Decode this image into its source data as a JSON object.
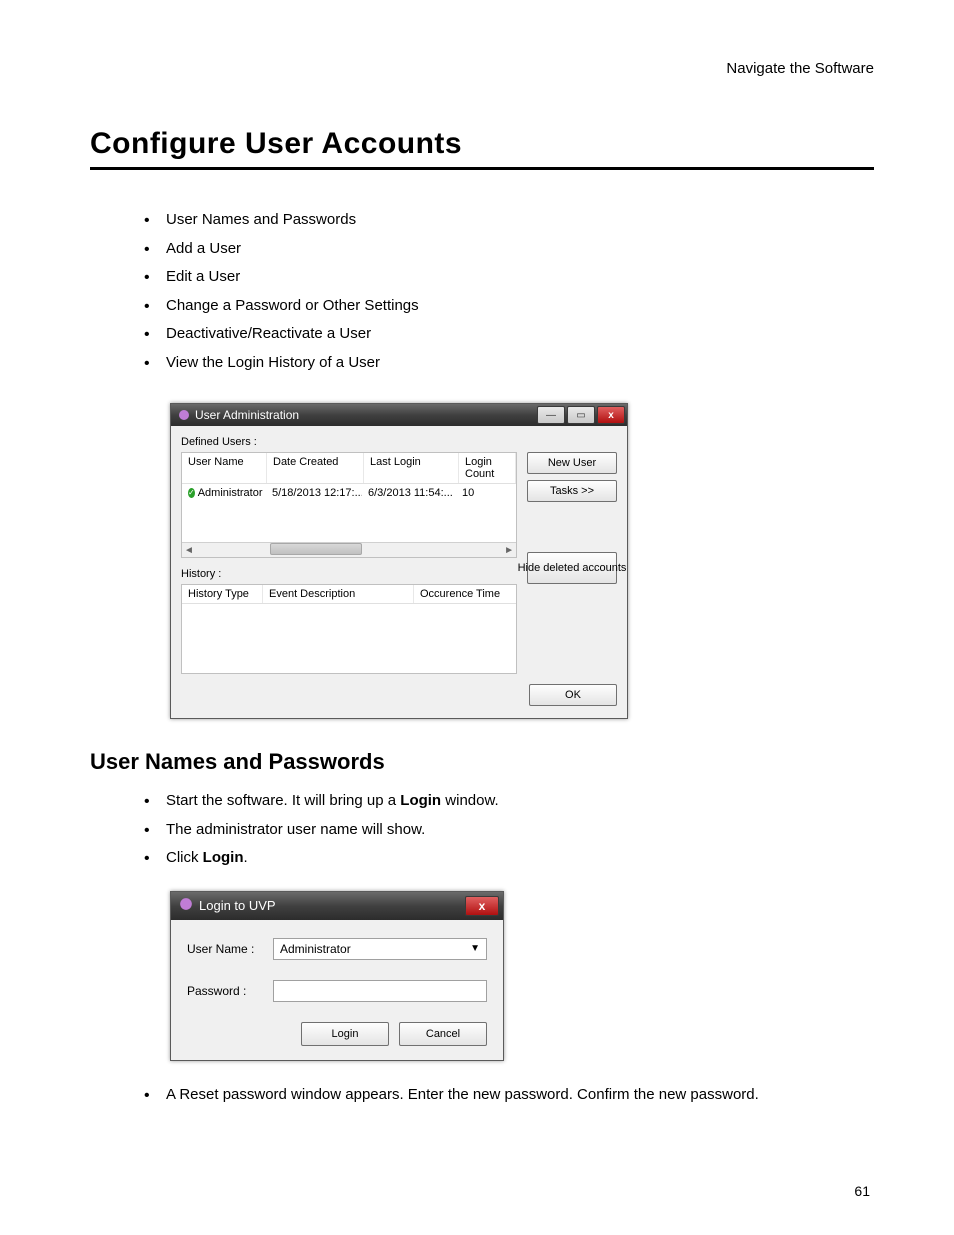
{
  "header_right": "Navigate the Software",
  "title": "Configure User Accounts",
  "toc": [
    "User Names and Passwords",
    "Add a User",
    "Edit a User",
    "Change a Password or Other Settings",
    "Deactivative/Reactivate a User",
    "View the Login History of a User"
  ],
  "dialog1": {
    "title": "User Administration",
    "defined_users_label": "Defined Users :",
    "headers": {
      "user_name": "User Name",
      "date_created": "Date Created",
      "last_login": "Last Login",
      "login_count": "Login Count"
    },
    "row": {
      "user_name": "Administrator",
      "date_created": "5/18/2013 12:17:...",
      "last_login": "6/3/2013 11:54:...",
      "login_count": "10"
    },
    "buttons": {
      "new_user": "New User",
      "tasks": "Tasks >>",
      "hide_deleted": "Hide deleted accounts",
      "ok": "OK"
    },
    "history_label": "History :",
    "history_headers": {
      "history_type": "History Type",
      "event_description": "Event Description",
      "occurence_time": "Occurence Time"
    }
  },
  "subheading": "User Names and Passwords",
  "steps1": {
    "s1a": "Start the software. It will bring up a ",
    "s1b": "Login",
    "s1c": " window.",
    "s2": "The administrator user name will show.",
    "s3a": "Click ",
    "s3b": "Login",
    "s3c": "."
  },
  "dialog2": {
    "title": "Login to UVP",
    "user_name_label": "User Name :",
    "user_name_value": "Administrator",
    "password_label": "Password  :",
    "password_value": "",
    "login": "Login",
    "cancel": "Cancel"
  },
  "step_after": "A Reset password window appears.  Enter the new password. Confirm the new password.",
  "page_num": "61"
}
